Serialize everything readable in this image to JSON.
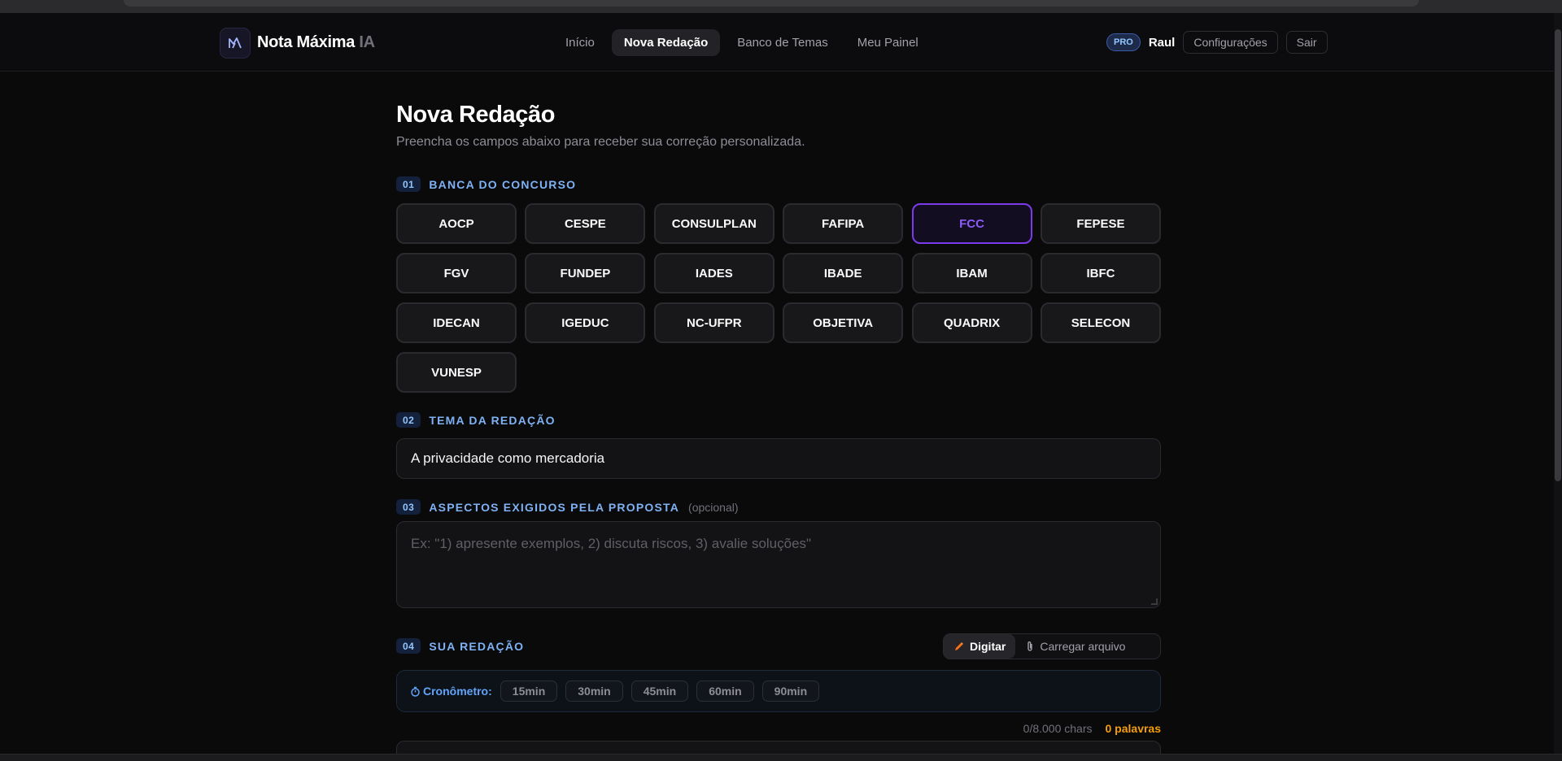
{
  "header": {
    "logo_main": "Nota Máxima",
    "logo_suffix": "IA",
    "nav": [
      "Início",
      "Nova Redação",
      "Banco de Temas",
      "Meu Painel"
    ],
    "badge": "PRO",
    "user": "Raul",
    "settings": "Configurações",
    "logout": "Sair"
  },
  "page": {
    "title": "Nova Redação",
    "subtitle": "Preencha os campos abaixo para receber sua correção personalizada."
  },
  "sections": {
    "banca": {
      "num": "01",
      "title": "BANCA DO CONCURSO"
    },
    "tema": {
      "num": "02",
      "title": "TEMA DA REDAÇÃO"
    },
    "aspectos": {
      "num": "03",
      "title": "ASPECTOS EXIGIDOS PELA PROPOSTA",
      "optional": "(opcional)"
    },
    "redacao": {
      "num": "04",
      "title": "SUA REDAÇÃO"
    }
  },
  "bancas": [
    "AOCP",
    "CESPE",
    "CONSULPLAN",
    "FAFIPA",
    "FCC",
    "FEPESE",
    "FGV",
    "FUNDEP",
    "IADES",
    "IBADE",
    "IBAM",
    "IBFC",
    "IDECAN",
    "IGEDUC",
    "NC-UFPR",
    "OBJETIVA",
    "QUADRIX",
    "SELECON",
    "VUNESP"
  ],
  "selected_banca": "FCC",
  "tema_value": "A privacidade como mercadoria",
  "aspectos_placeholder": "Ex: \"1) apresente exemplos, 2) discuta riscos, 3) avalie soluções\"",
  "mode": {
    "type": "Digitar",
    "upload": "Carregar arquivo"
  },
  "timer": {
    "label": "Cronômetro:",
    "options": [
      "15min",
      "30min",
      "45min",
      "60min",
      "90min"
    ]
  },
  "counter": {
    "chars": "0/8.000 chars",
    "words": "0 palavras"
  },
  "colors": {
    "accent": "#7c3aed",
    "section": "#7fb1f5",
    "warning": "#f59e0b"
  }
}
